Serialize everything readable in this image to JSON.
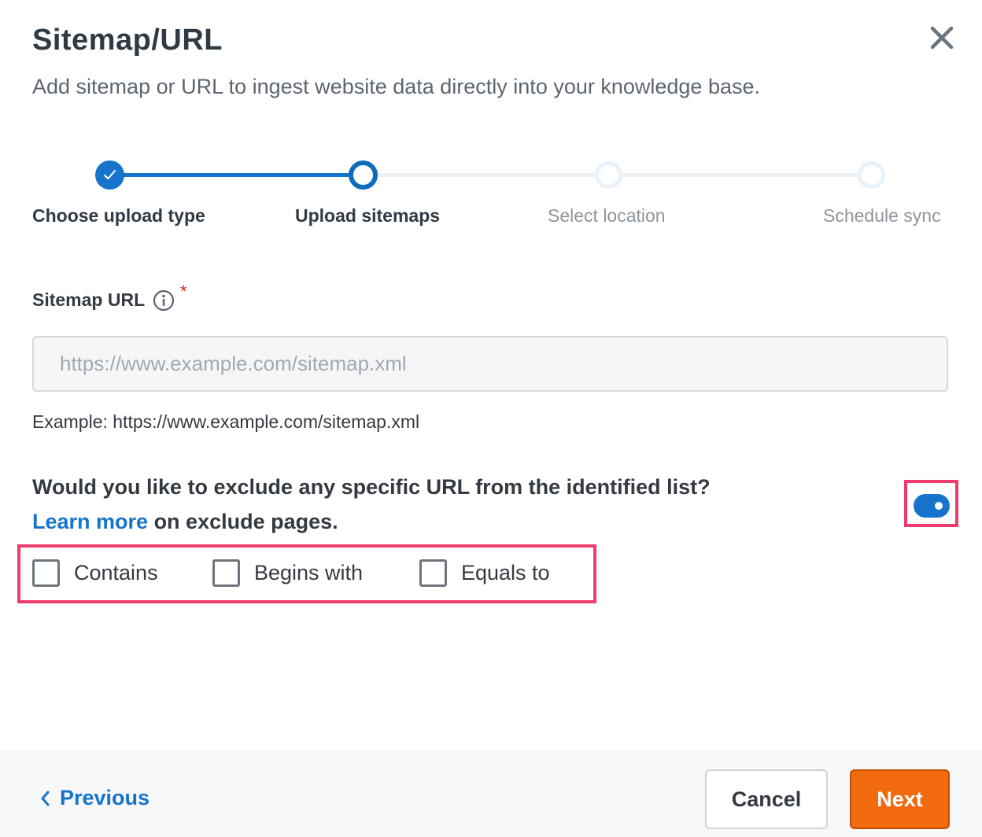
{
  "dialog": {
    "title": "Sitemap/URL",
    "subtitle": "Add sitemap or URL to ingest website data directly into your knowledge base.",
    "close_icon": "close-icon"
  },
  "stepper": {
    "steps": [
      {
        "label": "Choose upload type",
        "state": "completed"
      },
      {
        "label": "Upload sitemaps",
        "state": "current"
      },
      {
        "label": "Select location",
        "state": "upcoming"
      },
      {
        "label": "Schedule sync",
        "state": "upcoming"
      }
    ],
    "accent_color": "#1774cc"
  },
  "form": {
    "sitemap_label": "Sitemap URL",
    "required_marker": "*",
    "info_icon": "info-icon",
    "sitemap_value": "",
    "sitemap_placeholder": "https://www.example.com/sitemap.xml",
    "hint": "Example: https://www.example.com/sitemap.xml",
    "exclude_question": "Would you like to exclude any specific URL from the identified list?",
    "learn_more_link": "Learn more",
    "learn_more_suffix": " on exclude pages.",
    "exclude_toggle_on": true,
    "exclude_options": [
      {
        "label": "Contains",
        "checked": false
      },
      {
        "label": "Begins with",
        "checked": false
      },
      {
        "label": "Equals to",
        "checked": false
      }
    ]
  },
  "footer": {
    "previous_label": "Previous",
    "cancel_label": "Cancel",
    "next_label": "Next",
    "next_color": "#f16a0e"
  },
  "highlight_color": "#ef3b6e"
}
